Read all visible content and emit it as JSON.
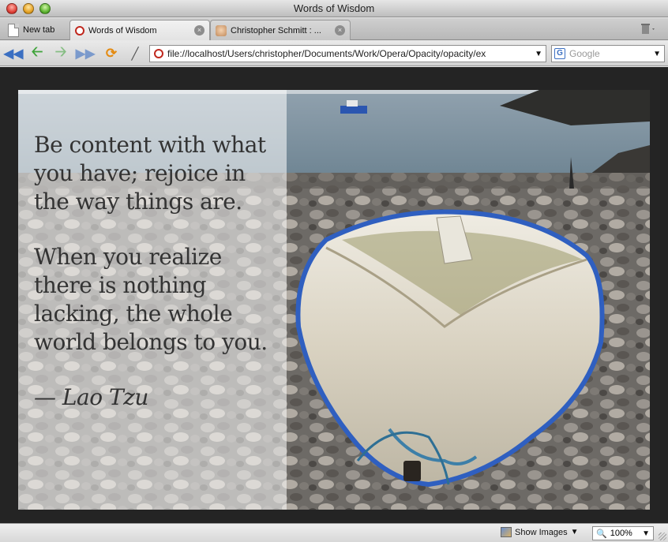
{
  "window": {
    "title": "Words of Wisdom"
  },
  "tabs": [
    {
      "label": "New tab"
    },
    {
      "label": "Words of Wisdom",
      "close": "×"
    },
    {
      "label": "Christopher Schmitt : ...",
      "close": "×"
    }
  ],
  "toolbar": {
    "address": "file://localhost/Users/christopher/Documents/Work/Opera/Opacity/opacity/ex",
    "search_placeholder": "Google",
    "search_engine_icon": "G"
  },
  "page": {
    "quote_line_1": "Be content with what you have; rejoice in the way things are.",
    "quote_line_2": "When you realize there is nothing lacking, the whole world belongs to you.",
    "author": "— Lao Tzu"
  },
  "statusbar": {
    "show_images": "Show Images",
    "zoom": "100%"
  },
  "colors": {
    "content_bg": "#242424",
    "overlay": "rgba(255,255,255,0.55)",
    "boat_trim": "#2f5fc0"
  },
  "icons": {
    "back": "rewind-icon",
    "prev": "back-arrow-icon",
    "next": "forward-arrow-icon",
    "fast_forward": "fast-forward-icon",
    "reload": "reload-icon",
    "wand": "wand-icon"
  }
}
